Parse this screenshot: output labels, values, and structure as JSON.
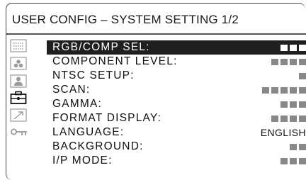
{
  "header": {
    "title": "USER CONFIG – SYSTEM SETTING 1/2"
  },
  "sidebar": {
    "icons": [
      {
        "name": "signal-grid-icon",
        "active": false
      },
      {
        "name": "color-dots-icon",
        "active": false
      },
      {
        "name": "person-icon",
        "active": false
      },
      {
        "name": "toolbox-icon",
        "active": true
      },
      {
        "name": "arrow-icon",
        "active": false
      },
      {
        "name": "key-icon",
        "active": false
      }
    ]
  },
  "menu": {
    "items": [
      {
        "label": "RGB/COMP SEL:",
        "selected": true,
        "blocks": 3
      },
      {
        "label": "COMPONENT LEVEL:",
        "selected": false,
        "blocks": 4
      },
      {
        "label": "NTSC SETUP:",
        "selected": false,
        "blocks": 1
      },
      {
        "label": "SCAN:",
        "selected": false,
        "blocks": 5
      },
      {
        "label": "GAMMA:",
        "selected": false,
        "blocks": 3
      },
      {
        "label": "FORMAT DISPLAY:",
        "selected": false,
        "blocks": 4
      },
      {
        "label": "LANGUAGE:",
        "selected": false,
        "value": "ENGLISH"
      },
      {
        "label": "BACKGROUND:",
        "selected": false,
        "blocks": 2
      },
      {
        "label": "I/P MODE:",
        "selected": false,
        "blocks": 3
      }
    ]
  },
  "colors": {
    "selected_bg": "#1f1f1f",
    "block_gray": "#888888",
    "icon_gray": "#999999",
    "text": "#111111"
  }
}
